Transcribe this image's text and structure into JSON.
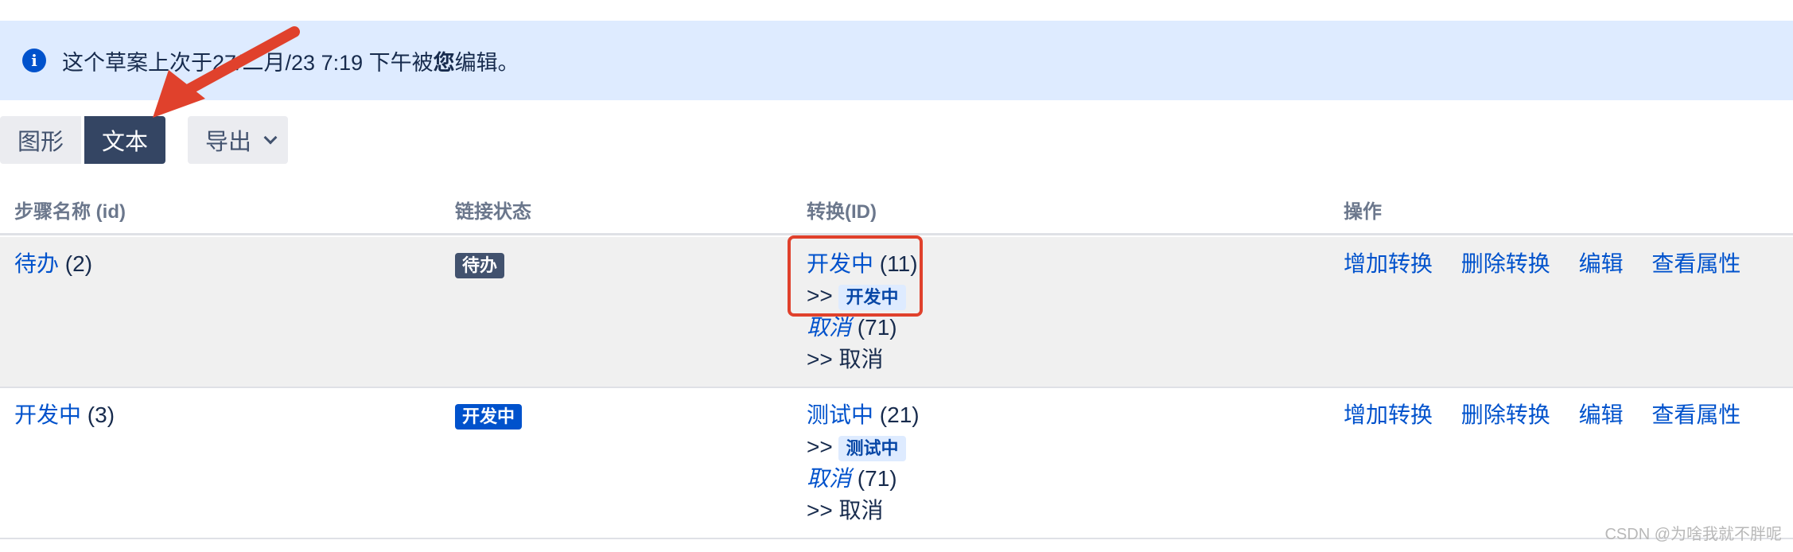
{
  "banner": {
    "icon": "info-icon",
    "text_before": "这个草案上次于27/二月/23 7:19 下午被",
    "text_bold": "您",
    "text_after": "编辑。"
  },
  "toolbar": {
    "graph_label": "图形",
    "text_label": "文本",
    "export_label": "导出"
  },
  "table": {
    "headers": [
      "步骤名称 (id)",
      "链接状态",
      "转换(ID)",
      "操作"
    ],
    "rows": [
      {
        "step_name": "待办",
        "step_id": "(2)",
        "status": "待办",
        "transitions": [
          {
            "name": "开发中",
            "id": "(11)",
            "prefix": ">>",
            "target": "开发中",
            "target_lozenge": true
          },
          {
            "name": "取消",
            "id": "(71)",
            "prefix": ">>",
            "target": "取消",
            "target_lozenge": false
          }
        ],
        "actions": [
          "增加转换",
          "删除转换",
          "编辑",
          "查看属性"
        ]
      },
      {
        "step_name": "开发中",
        "step_id": "(3)",
        "status": "开发中",
        "transitions": [
          {
            "name": "测试中",
            "id": "(21)",
            "prefix": ">>",
            "target": "测试中",
            "target_lozenge": true
          },
          {
            "name": "取消",
            "id": "(71)",
            "prefix": ">>",
            "target": "取消",
            "target_lozenge": false
          }
        ],
        "actions": [
          "增加转换",
          "删除转换",
          "编辑",
          "查看属性"
        ]
      }
    ]
  },
  "watermark": "CSDN @为啥我就不胖呢",
  "colors": {
    "banner_bg": "#deebff",
    "link": "#0052cc",
    "annotation_red": "#e0412c"
  }
}
